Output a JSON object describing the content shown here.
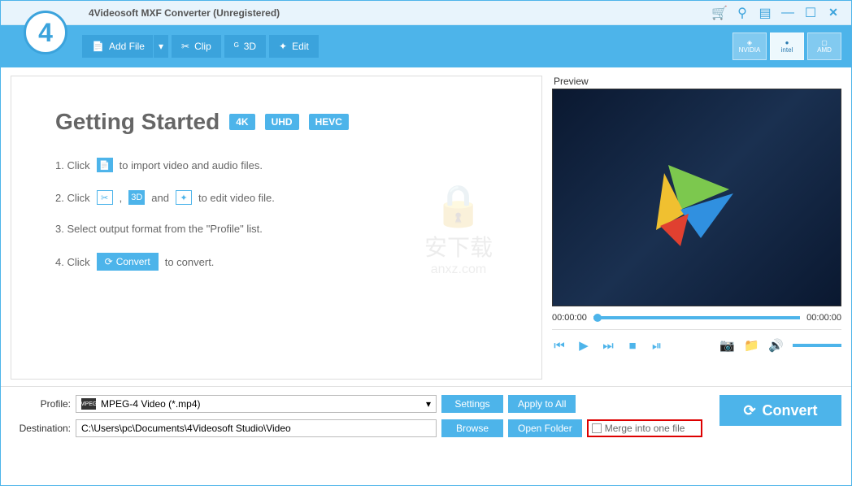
{
  "window": {
    "title": "4Videosoft MXF Converter (Unregistered)"
  },
  "toolbar": {
    "addFile": "Add File",
    "clip": "Clip",
    "threeD": "3D",
    "edit": "Edit"
  },
  "tech": {
    "nvidia": "NVIDIA",
    "intel": "intel",
    "amd": "AMD"
  },
  "gettingStarted": {
    "title": "Getting Started",
    "badges": [
      "4K",
      "UHD",
      "HEVC"
    ],
    "step1_a": "1. Click",
    "step1_b": "to import video and audio files.",
    "step2_a": "2. Click",
    "step2_comma": ",",
    "step2_and": "and",
    "step2_b": "to edit video file.",
    "step3": "3. Select output format from the \"Profile\" list.",
    "step4_a": "4. Click",
    "step4_convert": "Convert",
    "step4_b": "to convert."
  },
  "watermark": {
    "text": "安下载",
    "domain": "anxz.com"
  },
  "preview": {
    "label": "Preview",
    "timeStart": "00:00:00",
    "timeEnd": "00:00:00"
  },
  "profile": {
    "label": "Profile:",
    "value": "MPEG-4 Video (*.mp4)",
    "settings": "Settings",
    "applyAll": "Apply to All"
  },
  "destination": {
    "label": "Destination:",
    "value": "C:\\Users\\pc\\Documents\\4Videosoft Studio\\Video",
    "browse": "Browse",
    "openFolder": "Open Folder"
  },
  "merge": {
    "label": "Merge into one file"
  },
  "convert": {
    "label": "Convert"
  }
}
